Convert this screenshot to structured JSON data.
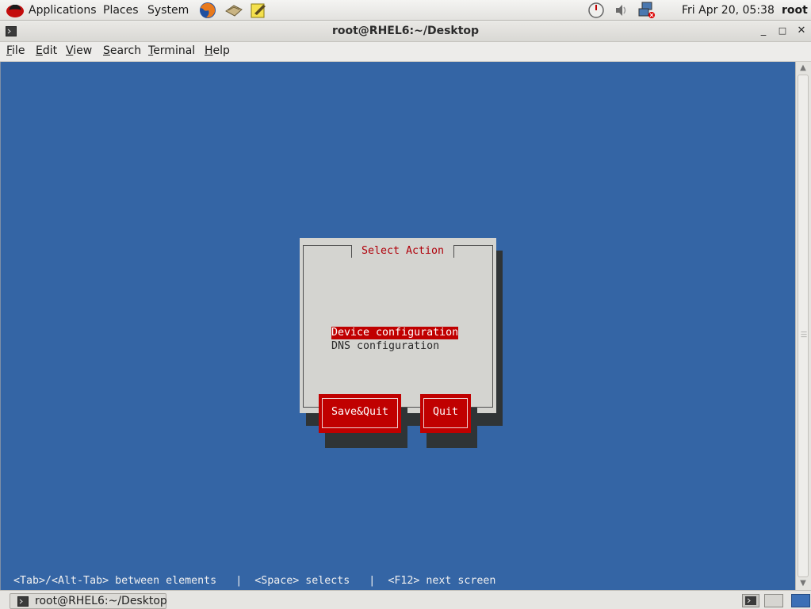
{
  "top_panel": {
    "menus": [
      "Applications",
      "Places",
      "System"
    ],
    "clock": "Fri Apr 20, 05:38",
    "user": "root",
    "launchers": [
      "firefox-icon",
      "mail-icon",
      "notes-icon"
    ],
    "tray_icons": [
      "update-monitor-icon",
      "volume-icon",
      "network-icon"
    ]
  },
  "window": {
    "title": "root@RHEL6:~/Desktop",
    "minimize": "_",
    "maximize": "□",
    "close": "✕"
  },
  "menubar": {
    "items": [
      {
        "mnemonic": "F",
        "rest": "ile"
      },
      {
        "mnemonic": "E",
        "rest": "dit"
      },
      {
        "mnemonic": "V",
        "rest": "iew"
      },
      {
        "mnemonic": "S",
        "rest": "earch"
      },
      {
        "mnemonic": "T",
        "rest": "erminal"
      },
      {
        "mnemonic": "H",
        "rest": "elp"
      }
    ]
  },
  "dialog": {
    "title": "Select Action",
    "items": [
      "Device configuration",
      "DNS configuration"
    ],
    "selected_index": 0,
    "buttons": {
      "save_quit": "Save&Quit",
      "quit": "Quit"
    }
  },
  "hint_line": "<Tab>/<Alt-Tab> between elements   |  <Space> selects   |  <F12> next screen",
  "taskbar": {
    "task_label": "root@RHEL6:~/Desktop"
  },
  "colors": {
    "terminal_bg": "#3465a5",
    "dialog_bg": "#d4d4d0",
    "accent_red": "#c00000",
    "shadow": "#2f3436"
  }
}
